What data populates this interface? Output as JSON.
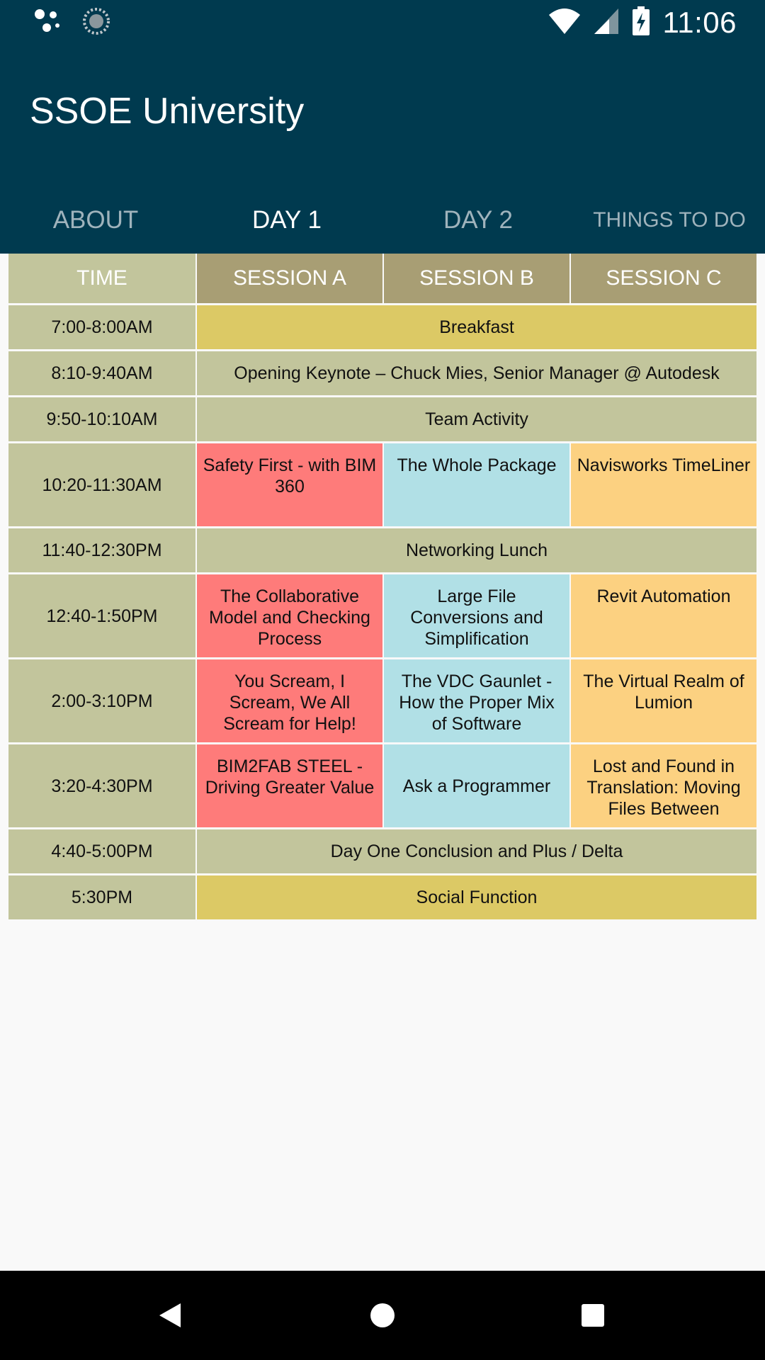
{
  "status_bar": {
    "time": "11:06",
    "icons": [
      "assistant-dots-icon",
      "loading-circle-icon",
      "wifi-icon",
      "cell-signal-icon",
      "battery-charging-icon"
    ]
  },
  "app": {
    "title": "SSOE University"
  },
  "tabs": [
    {
      "label": "ABOUT",
      "active": false
    },
    {
      "label": "DAY 1",
      "active": true
    },
    {
      "label": "DAY 2",
      "active": false
    },
    {
      "label": "THINGS TO DO",
      "active": false
    }
  ],
  "schedule": {
    "headers": [
      "TIME",
      "SESSION A",
      "SESSION B",
      "SESSION C"
    ],
    "rows": [
      {
        "time": "7:00-8:00AM",
        "all": "Breakfast"
      },
      {
        "time": "8:10-9:40AM",
        "all": "Opening Keynote – Chuck Mies, Senior Manager @ Autodesk"
      },
      {
        "time": "9:50-10:10AM",
        "all": "Team Activity"
      },
      {
        "time": "10:20-11:30AM",
        "a": "Safety First - with BIM 360",
        "b": "The Whole Package",
        "c": "Navisworks TimeLiner"
      },
      {
        "time": "11:40-12:30PM",
        "all": "Networking Lunch"
      },
      {
        "time": "12:40-1:50PM",
        "a": "The Collaborative Model and Checking Process",
        "b": "Large File Conversions and Simplification",
        "c": "Revit Automation"
      },
      {
        "time": "2:00-3:10PM",
        "a": "You Scream, I Scream, We All Scream for Help!",
        "b": "The VDC Gaunlet - How the Proper Mix of Software",
        "c": "The Virtual Realm of Lumion"
      },
      {
        "time": "3:20-4:30PM",
        "a": "BIM2FAB STEEL - Driving Greater Value",
        "b": "Ask a Programmer",
        "c": "Lost and Found in Translation: Moving Files Between"
      },
      {
        "time": "4:40-5:00PM",
        "all": "Day One Conclusion and Plus / Delta"
      },
      {
        "time": "5:30PM",
        "all": "Social Function"
      }
    ]
  },
  "colors": {
    "app_bar": "#003a4f",
    "time_column": "#c2c59c",
    "session_header": "#a89e74",
    "meal_row": "#dcc965",
    "general_row": "#c2c59c",
    "session_a": "#fe7b7a",
    "session_b": "#b1e0e6",
    "session_c": "#fcd181"
  },
  "nav_bar": {
    "buttons": [
      "back-icon",
      "home-icon",
      "recents-icon"
    ]
  }
}
